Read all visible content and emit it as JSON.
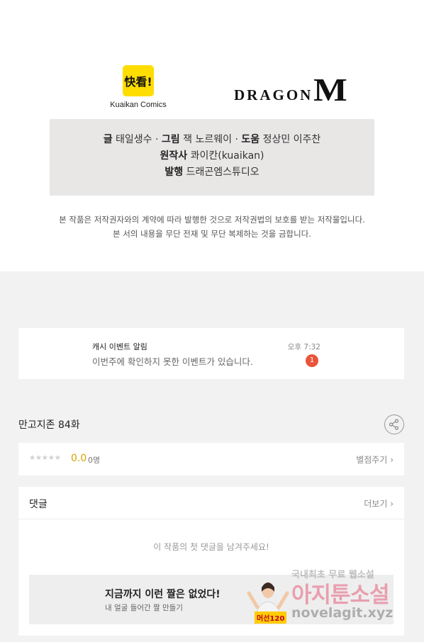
{
  "credits": {
    "kuaikan_logo_text": "快看!",
    "kuaikan_name": "Kuaikan Comics",
    "dragon_text": "DRAGON",
    "dragon_m": "M",
    "line1": [
      {
        "label": "글",
        "value": "태일생수"
      },
      {
        "label": "그림",
        "value": "잭 노르웨이"
      },
      {
        "label": "도움",
        "value": "정상민 이주찬"
      }
    ],
    "line2": {
      "label": "원작사",
      "value": "콰이칸(kuaikan)"
    },
    "line3": {
      "label": "발행",
      "value": "드래곤엠스튜디오"
    },
    "separator": "·",
    "copyright_line1": "본 작품은 저작권자와의 계약에 따라 발행한 것으로 저작권법의 보호를 받는 저작물입니다.",
    "copyright_line2": "본 서의 내용을 무단 전재 및 무단 복제하는 것을 금합니다."
  },
  "notice": {
    "title": "캐시 이벤트 알림",
    "message": "이번주에 확인하지 못한 이벤트가 있습니다.",
    "time": "오후 7:32",
    "badge": "1"
  },
  "episode": {
    "title": "만고지존 84화",
    "share_icon": "share-icon"
  },
  "rating": {
    "stars": "★★★★★",
    "score": "0.0",
    "count": "0명",
    "rate_label": "별점주기",
    "chevron": "›",
    "filled_stars": 0
  },
  "comments": {
    "title": "댓글",
    "more_label": "더보기",
    "chevron": "›",
    "empty_message": "이 작품의 첫 댓글을 남겨주세요!"
  },
  "ad": {
    "title": "지금까지 이런 짤은 없었다!",
    "subtitle": "내 얼굴 들어간 짤 만들기",
    "tag": "머선120"
  },
  "watermark": {
    "line1": "국내최초 무료 웹소설",
    "line2": "아지툰소설",
    "line3": "novelagit.xyz"
  },
  "colors": {
    "accent_yellow": "#ffdd00",
    "badge_red": "#e8553b",
    "score_gold": "#d4a300",
    "page_bg": "#f2f2f2"
  }
}
